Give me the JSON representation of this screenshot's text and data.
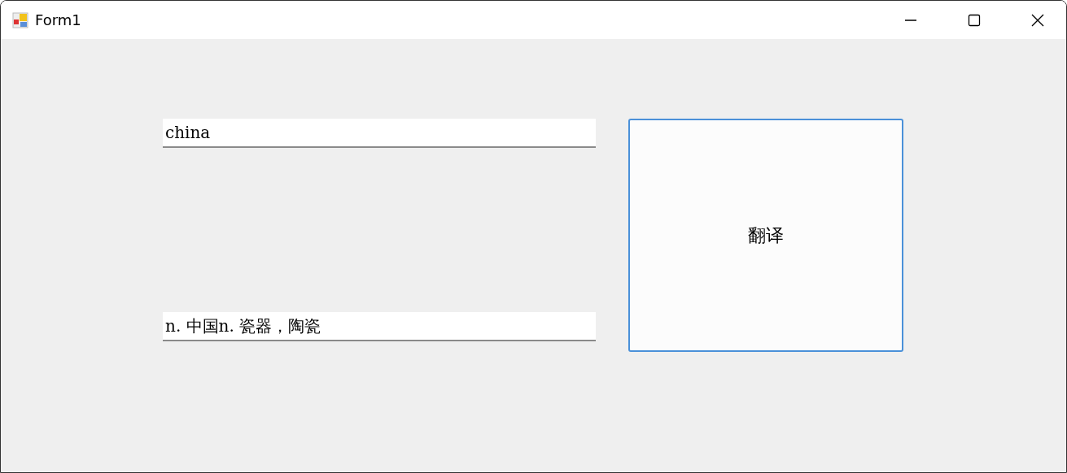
{
  "window": {
    "title": "Form1"
  },
  "fields": [
    {
      "value": "china"
    },
    {
      "value": "n. 中国n. 瓷器，陶瓷"
    }
  ],
  "button": {
    "label": "翻译",
    "focused": true
  }
}
